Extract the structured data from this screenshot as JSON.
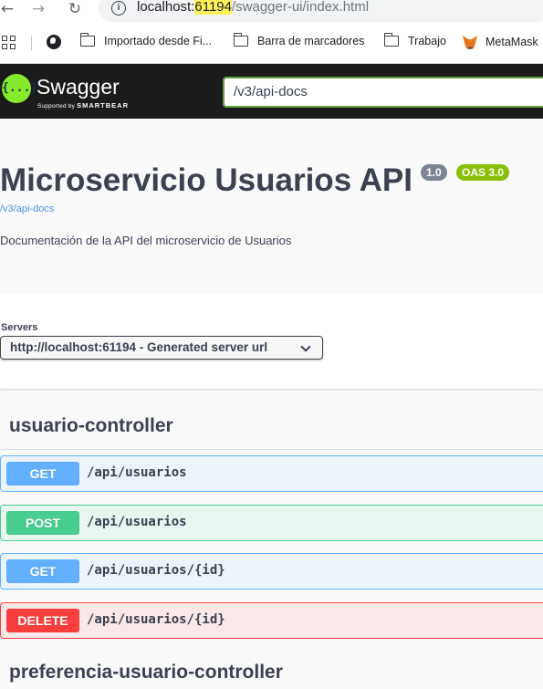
{
  "browser": {
    "url_host": "localhost:",
    "url_port": "61194",
    "url_path": "/swagger-ui/index.html",
    "bookmarks": [
      {
        "label": "Importado desde Fi..."
      },
      {
        "label": "Barra de marcadores"
      },
      {
        "label": "Trabajo"
      },
      {
        "label": "MetaMask"
      }
    ]
  },
  "topbar": {
    "logo_icon": "{...}",
    "logo_name": "Swagger",
    "logo_sub": "Supported by",
    "logo_brand": "SMARTBEAR",
    "spec_url": "/v3/api-docs"
  },
  "info": {
    "title": "Microservicio Usuarios API",
    "version": "1.0",
    "oas": "OAS 3.0",
    "spec_link": "/v3/api-docs",
    "description": "Documentación de la API del microservicio de Usuarios"
  },
  "servers": {
    "label": "Servers",
    "selected": "http://localhost:61194 - Generated server url"
  },
  "tags": [
    {
      "name": "usuario-controller",
      "operations": [
        {
          "method": "GET",
          "path": "/api/usuarios"
        },
        {
          "method": "POST",
          "path": "/api/usuarios"
        },
        {
          "method": "GET",
          "path": "/api/usuarios/{id}"
        },
        {
          "method": "DELETE",
          "path": "/api/usuarios/{id}"
        }
      ]
    },
    {
      "name": "preferencia-usuario-controller",
      "operations": []
    }
  ],
  "colors": {
    "get": "#61affe",
    "post": "#49cc90",
    "delete": "#f93e3e",
    "swagger_green": "#85ea2d",
    "topbar": "#1b1b1b"
  }
}
